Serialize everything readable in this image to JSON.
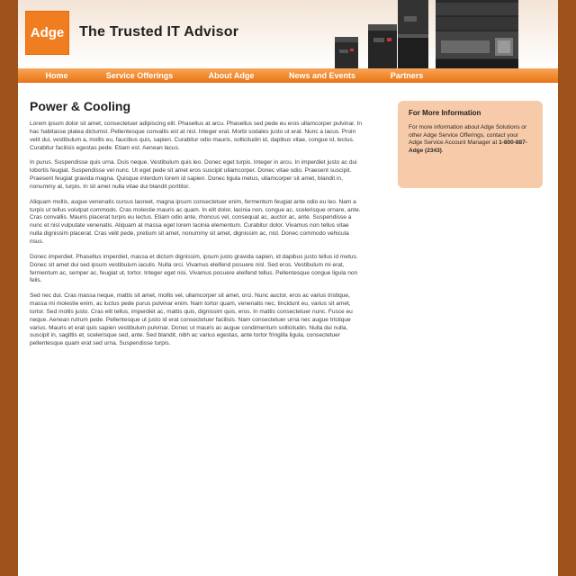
{
  "header": {
    "logo_text": "Adge",
    "tagline": "The Trusted IT Advisor",
    "accent_color": "#f07d1f",
    "background_color": "#a0521c"
  },
  "nav": {
    "items": [
      {
        "label": "Home"
      },
      {
        "label": "Service Offerings"
      },
      {
        "label": "About Adge"
      },
      {
        "label": "News and Events"
      },
      {
        "label": "Partners"
      }
    ]
  },
  "main": {
    "title": "Power & Cooling",
    "paragraphs": [
      "Lorem ipsum dolor sit amet, consectetuer adipiscing elit. Phasellus at arcu. Phasellus sed pede eu eros ullamcorper pulvinar. In hac habitasse platea dictumst. Pellentesque convallis est at nisl. Integer erat. Morbi sodales justo ut erat. Nunc a lacus. Proin velit dui, vestibulum a, mollis eu, faucibus quis, sapien. Curabitur odio mauris, sollicitudin id, dapibus vitae, congue id, lectus. Curabitur facilisis egestas pede. Etiam est. Aenean lacus.",
      "In purus. Suspendisse quis urna. Duis neque. Vestibulum quis leo. Donec eget turpis. Integer in arcu. In imperdiet justo ac dui lobortis feugiat. Suspendisse vel nunc. Ut eget pede sit amet eros suscipit ullamcorper. Donec vitae odio. Praesent suscipit. Praesent feugiat gravida magna. Quisque interdum lorem id sapien. Donec ligula metus, ullamcorper sit amet, blandit in, nonummy at, turpis. In sit amet nulla vitae dui blandit porttitor.",
      "Aliquam mollis, augue venenatis cursus laoreet, magna ipsum consectetuer enim, fermentum feugiat ante odio eu leo. Nam a turpis ut tellus volutpat commodo. Cras molestie mauris ac quam. In elit dolor, lacinia non, congue ac, scelerisque ornare, ante. Cras convallis. Mauris placerat turpis eu lectus. Etiam odio ante, rhoncus vel, consequat ac, auctor ac, ante. Suspendisse a nunc et nisl vulputate venenatis. Aliquam at massa eget lorem lacinia elementum. Curabitur dolor. Vivamus non tellus vitae nulla dignissim placerat. Cras velit pede, pretium sit amet, nonummy sit amet, dignissim ac, nisl. Donec commodo vehicula risus.",
      "Donec imperdiet. Phasellus imperdiet, massa et dictum dignissim, ipsum justo gravida sapien, id dapibus justo tellus id metus. Donec sit amet dui sed ipsum vestibulum iaculis. Nulla orci. Vivamus eleifend posuere nisl. Sed eros. Vestibulum mi erat, fermentum ac, semper ac, feugiat ut, tortor. Integer eget nisi. Vivamus posuere eleifend tellus. Pellentesque congue ligula non felis.",
      "Sed nec dui. Cras massa neque, mattis sit amet, mollis vel, ullamcorper sit amet, orci. Nunc auctor, eros ac varius tristique, massa mi molestie enim, ac luctus pede purus pulvinar enim. Nam tortor quam, venenatis nec, tincidunt eu, varius sit amet, tortor. Sed mollis justo. Cras elit tellus, imperdiet ac, mattis quis, dignissim quis, eros. In mattis consectetuer nunc. Fusce eu neque. Aenean rutrum pede. Pellentesque ut justo id erat consectetuer facilisis. Nam consectetuer urna nec augue tristique varius. Mauris et erat quis sapien vestibulum pulvinar. Donec ut mauris ac augue condimentum sollicitudin. Nulla dui nulla, suscipit in, sagittis et, scelerisque sed, ante. Sed blandit, nibh ac varius egestas, ante tortor fringilla ligula, consectetuer pellentesque quam erat sed urna. Suspendisse turpis."
    ]
  },
  "sidebar": {
    "title": "For More Information",
    "text": "For more information about Adge Solutions or other Adge Service Offerings, contact your Adge Service Account Manager at ",
    "phone": "1-800-887-Adge (2343)",
    "text_end": ".",
    "box_color": "#f7cbaa"
  }
}
